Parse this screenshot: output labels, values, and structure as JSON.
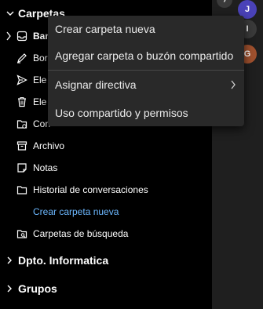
{
  "folders_group": {
    "title": "Carpetas",
    "items": [
      {
        "label": "Ban",
        "icon": "inbox-icon"
      },
      {
        "label": "Borr",
        "icon": "draft-pencil-icon"
      },
      {
        "label": "Ele",
        "icon": "send-icon"
      },
      {
        "label": "Ele",
        "icon": "trash-icon"
      },
      {
        "label": "Corr",
        "icon": "junk-folder-icon"
      },
      {
        "label": "Archivo",
        "icon": "archive-icon"
      },
      {
        "label": "Notas",
        "icon": "note-icon"
      },
      {
        "label": "Historial de conversaciones",
        "icon": "folder-icon"
      }
    ],
    "new_folder_link": "Crear carpeta nueva",
    "search_folders": {
      "label": "Carpetas de búsqueda",
      "icon": "search-folder-icon"
    }
  },
  "other_groups": [
    {
      "title": "Dpto. Informatica"
    },
    {
      "title": "Grupos"
    }
  ],
  "context_menu": {
    "items": [
      {
        "label": "Crear carpeta nueva"
      },
      {
        "label": "Agregar carpeta o buzón compartido"
      },
      {
        "label": "Asignar directiva",
        "has_submenu": true
      },
      {
        "label": "Uso compartido y permisos"
      }
    ]
  },
  "avatars": [
    {
      "initial": "J",
      "color": "#4a42b8"
    },
    {
      "initial": "I",
      "color": "#3a3a3a"
    },
    {
      "initial": "G",
      "color": "#a0512e"
    }
  ],
  "colors": {
    "link": "#6cb8ff",
    "menu_bg": "#292929",
    "pane_bg": "#000000"
  }
}
